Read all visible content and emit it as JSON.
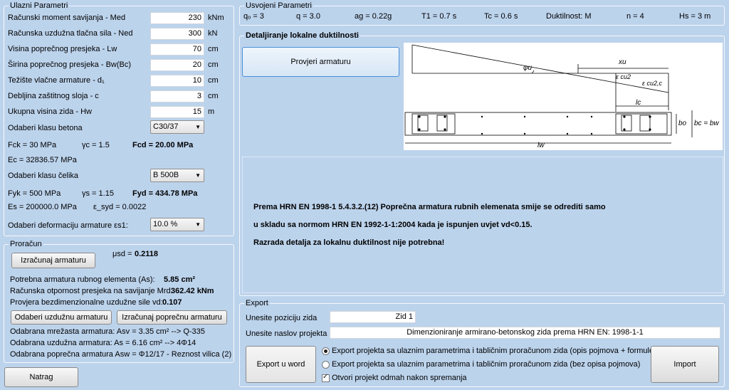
{
  "inputs": {
    "title": "Ulazni Parametri",
    "fields": [
      {
        "label": "Računski moment savijanja - Med",
        "value": "230",
        "unit": "kNm"
      },
      {
        "label": "Računska uzdužna tlačna sila - Ned",
        "value": "300",
        "unit": "kN"
      },
      {
        "label": "Visina poprečnog presjeka - Lw",
        "value": "70",
        "unit": "cm"
      },
      {
        "label": "Širina poprečnog presjeka - Bw(Bc)",
        "value": "20",
        "unit": "cm"
      },
      {
        "label": "Težište vlačne armature - d₁",
        "value": "10",
        "unit": "cm"
      },
      {
        "label": "Debljina zaštitnog sloja - c",
        "value": "3",
        "unit": "cm"
      },
      {
        "label": "Ukupna visina zida - Hw",
        "value": "15",
        "unit": "m"
      }
    ],
    "concrete_label": "Odaberi klasu betona",
    "concrete_value": "C30/37",
    "fck": "Fck = 30  MPa",
    "gamma_c": "γc =  1.5",
    "fcd": "Fcd = 20.00 MPa",
    "ec": "Ec =  32836.57 MPa",
    "steel_label": "Odaberi klasu čelika",
    "steel_value": "B 500B",
    "fyk": "Fyk = 500  MPa",
    "gamma_s": "γs =  1.15",
    "fyd": "Fyd = 434.78 MPa",
    "es": "Es =  200000.0 MPa",
    "eps_syd": "ε_syd = 0.0022",
    "deform_label": "Odaberi deformaciju armature εs1:",
    "deform_value": "10.0 %"
  },
  "calc": {
    "title": "Proračun",
    "btn_calc": "Izračunaj armaturu",
    "musd_label": "μsd =",
    "musd_value": "0.2118",
    "as_label": "Potrebna armatura rubnog elementa (As):",
    "as_value": "5.85 cm²",
    "mrd_label": "Računska otpornost presjeka na savijanje Mrd:",
    "mrd_value": "362.42 kNm",
    "vd_label": "Provjera bezdimenzionalne uzdužne sile vd:",
    "vd_value": "0.107",
    "btn_long": "Odaberi uzdužnu armaturu",
    "btn_trans": "Izračunaj poprečnu armaturu",
    "mesh": "Odabrana mrežasta armatura: Asv = 3.35 cm²  -->  Q-335",
    "long": "Odabrana uzdužna armatura: As = 6.16 cm²  -->  4Φ14",
    "trans": "Odabrana poprečna armatura Asw = Φ12/17 - Reznost vilica (2)"
  },
  "back_button": "Natrag",
  "adopted": {
    "title": "Usvojeni Parametri",
    "items": [
      "qₒ = 3",
      "q = 3.0",
      "ag = 0.22g",
      "T1 = 0.7 s",
      "Tc = 0.6 s",
      "Duktilnost: M",
      "n = 4",
      "Hs = 3 m"
    ]
  },
  "detail": {
    "title": "Detaljiranje lokalne duktilnosti",
    "btn_check": "Provjeri armaturu",
    "fig": {
      "phi": "φu",
      "xu": "xu",
      "ecu2": "ε cu2",
      "ecu2c": "ε cu2,c",
      "lc": "lc",
      "bo": "bo",
      "bcbw": "bc = bw",
      "lw": "lw"
    },
    "msg1": "Prema HRN EN 1998-1  5.4.3.2.(12) Poprečna armatura rubnih elemenata smije se odrediti samo",
    "msg2": "u skladu sa normom HRN EN 1992-1-1:2004 kada je ispunjen uvjet vd<0.15.",
    "msg3": "Razrada detalja za lokalnu duktilnost nije potrebna!"
  },
  "export": {
    "title": "Export",
    "pos_label": "Unesite poziciju zida",
    "pos_value": "Zid 1",
    "proj_label": "Unesite naslov projekta",
    "proj_value": "Dimenzioniranje armirano-betonskog zida prema HRN EN: 1998-1-1",
    "btn_word": "Export u word",
    "radio1": "Export projekta sa ulaznim parametrima i tabličnim proračunom zida (opis pojmova + formule)",
    "radio2": "Export projekta sa ulaznim parametrima i tabličnim proračunom zida (bez opisa pojmova)",
    "check": "Otvori projekt odmah nakon spremanja",
    "btn_import": "Import"
  }
}
